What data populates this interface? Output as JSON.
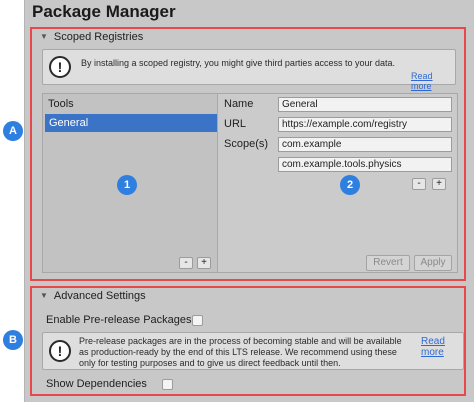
{
  "window": {
    "title": "Package Manager"
  },
  "callouts": {
    "a": "A",
    "b": "B",
    "one": "1",
    "two": "2"
  },
  "scoped_registries": {
    "header": "Scoped Registries",
    "info_text": "By installing a scoped registry, you might give third parties access to your data.",
    "info_link": "Read more",
    "list_header": "Tools",
    "list_items": [
      "General"
    ],
    "fields": {
      "name_label": "Name",
      "name_value": "General",
      "url_label": "URL",
      "url_value": "https://example.com/registry",
      "scopes_label": "Scope(s)",
      "scope_1": "com.example",
      "scope_2": "com.example.tools.physics"
    },
    "scope_remove": "-",
    "scope_add": "+",
    "list_remove": "-",
    "list_add": "+",
    "revert_label": "Revert",
    "apply_label": "Apply"
  },
  "advanced_settings": {
    "header": "Advanced Settings",
    "prerelease_label": "Enable Pre-release Packages",
    "info_text_lines": [
      "Pre-release packages are in the process of becoming stable and will be available",
      "as production-ready by the end of this LTS release. We recommend using these",
      "only for testing purposes and to give us direct feedback until then."
    ],
    "info_link": "Read more",
    "show_dependencies_label": "Show Dependencies"
  },
  "colors": {
    "callout": "#2f7fe0",
    "highlight_border": "#e8474c",
    "selection": "#3b73c6",
    "link": "#2e6ad6"
  },
  "icons": {
    "collapse": "triangle-down-icon",
    "info": "exclamation-icon"
  }
}
